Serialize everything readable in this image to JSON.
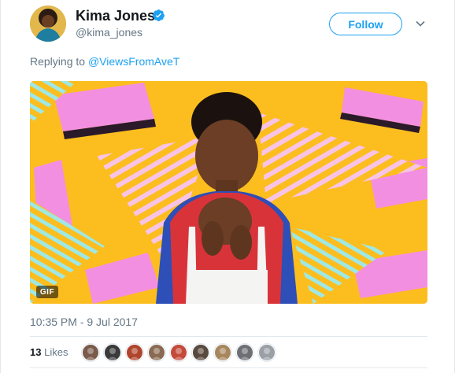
{
  "tweet": {
    "author_name": "Kima Jones",
    "author_handle": "@kima_jones",
    "follow_label": "Follow",
    "reply_prefix": "Replying to",
    "reply_handle": "@ViewsFromAveT",
    "media_badge": "GIF",
    "timestamp": "10:35 PM - 9 Jul 2017",
    "likes_count": "13",
    "likes_label": "Likes"
  },
  "icons": {
    "verified": "verified-badge-icon",
    "caret": "chevron-down-icon"
  },
  "likers": [
    {
      "name": "liker-avatar-1",
      "color": "#7a5a4a"
    },
    {
      "name": "liker-avatar-2",
      "color": "#3a3a3a"
    },
    {
      "name": "liker-avatar-3",
      "color": "#b0442c"
    },
    {
      "name": "liker-avatar-4",
      "color": "#8a6a52"
    },
    {
      "name": "liker-avatar-5",
      "color": "#c44a3a"
    },
    {
      "name": "liker-avatar-6",
      "color": "#5a4a3e"
    },
    {
      "name": "liker-avatar-7",
      "color": "#a8865e"
    },
    {
      "name": "liker-avatar-8",
      "color": "#6c6f74"
    },
    {
      "name": "liker-avatar-9",
      "color": "#9aa0a6"
    }
  ],
  "colors": {
    "accent": "#1da1f2",
    "muted_text": "#657786",
    "media_background": "#fcbd1f",
    "media_pink": "#f38fe0"
  }
}
